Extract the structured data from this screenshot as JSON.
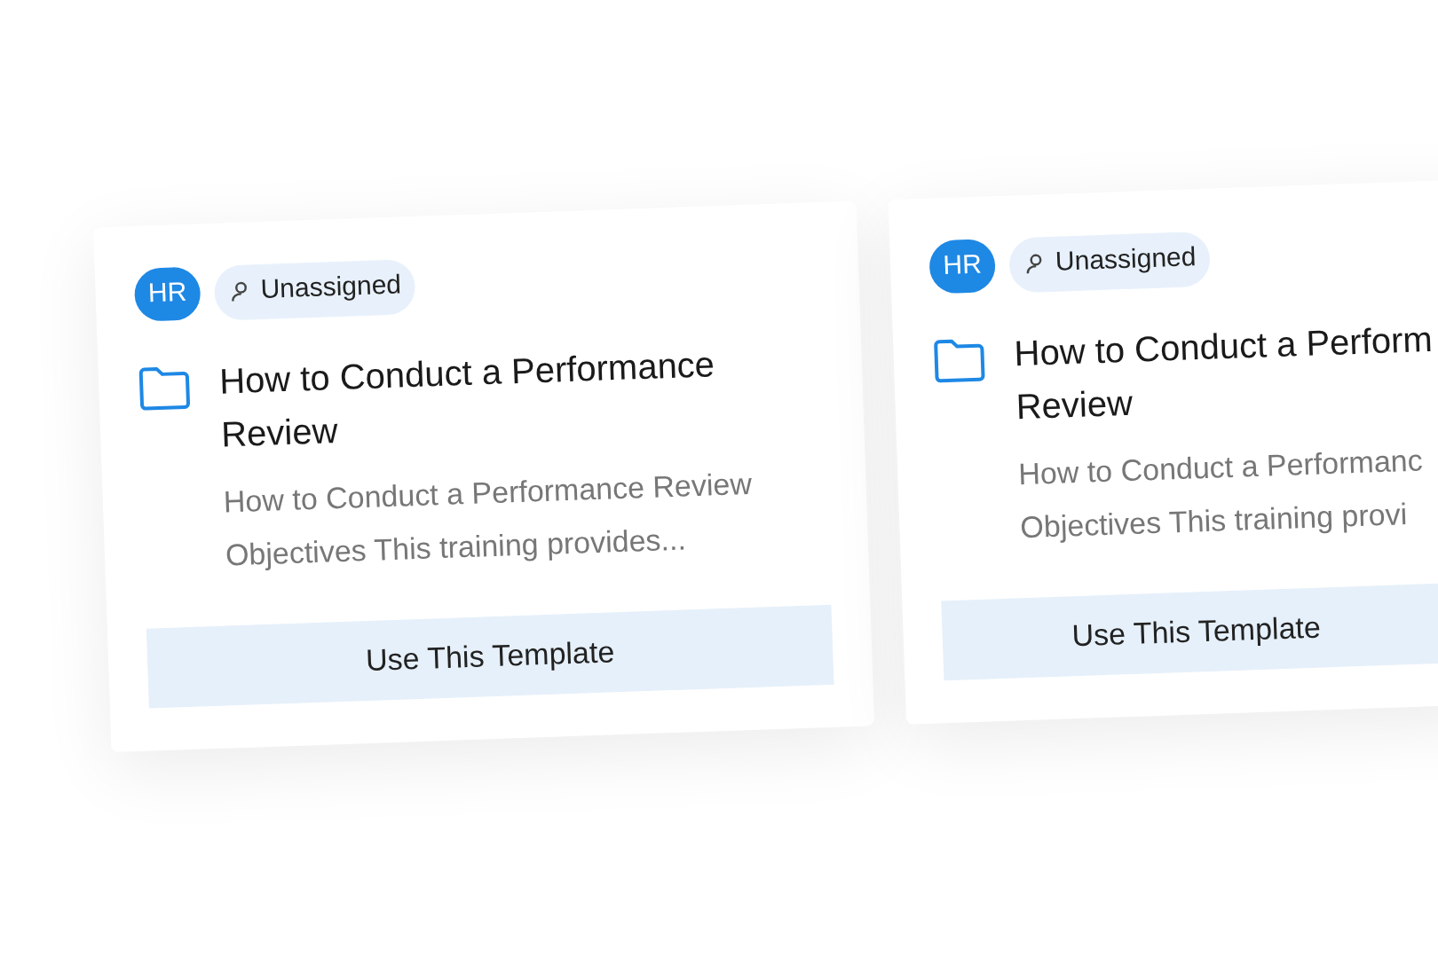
{
  "cards": [
    {
      "badge": "HR",
      "status": "Unassigned",
      "title_lines": [
        "How to Conduct a Performance",
        "Review"
      ],
      "description_lines": [
        "How to Conduct a Performance Review",
        "Objectives This training provides..."
      ],
      "button": "Use This Template"
    },
    {
      "badge": "HR",
      "status": "Unassigned",
      "title_lines": [
        "How to Conduct a Perform",
        "Review"
      ],
      "description_lines": [
        "How to Conduct a Performanc",
        "Objectives This training provi"
      ],
      "button": "Use This Template"
    }
  ]
}
